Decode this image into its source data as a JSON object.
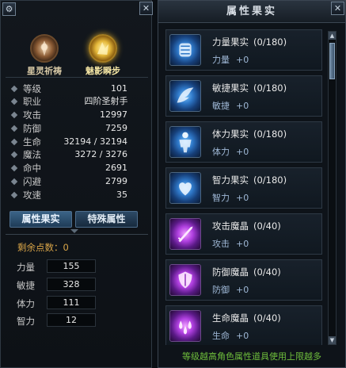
{
  "left_panel": {
    "skills": [
      {
        "name": "星灵祈祷"
      },
      {
        "name": "魅影瞬步"
      }
    ],
    "stats": [
      {
        "label": "等级",
        "value": "101"
      },
      {
        "label": "职业",
        "value": "四阶圣射手"
      },
      {
        "label": "攻击",
        "value": "12997"
      },
      {
        "label": "防御",
        "value": "7259"
      },
      {
        "label": "生命",
        "value": "32194 / 32194"
      },
      {
        "label": "魔法",
        "value": "3272 / 3276"
      },
      {
        "label": "命中",
        "value": "2691"
      },
      {
        "label": "闪避",
        "value": "2799"
      },
      {
        "label": "攻速",
        "value": "35"
      }
    ],
    "tabs": {
      "fruit": "属性果实",
      "special": "特殊属性"
    },
    "remaining_label": "剩余点数：0",
    "attributes": [
      {
        "label": "力量",
        "value": "155"
      },
      {
        "label": "敏捷",
        "value": "328"
      },
      {
        "label": "体力",
        "value": "111"
      },
      {
        "label": "智力",
        "value": "12"
      }
    ]
  },
  "right_panel": {
    "title": "属性果实",
    "items": [
      {
        "name": "力量果实",
        "count": "(0/180)",
        "stat": "力量",
        "bonus": "+0",
        "color": "blue",
        "icon": "fist-icon"
      },
      {
        "name": "敏捷果实",
        "count": "(0/180)",
        "stat": "敏捷",
        "bonus": "+0",
        "color": "blue",
        "icon": "wing-icon"
      },
      {
        "name": "体力果实",
        "count": "(0/180)",
        "stat": "体力",
        "bonus": "+0",
        "color": "blue",
        "icon": "body-icon"
      },
      {
        "name": "智力果实",
        "count": "(0/180)",
        "stat": "智力",
        "bonus": "+0",
        "color": "blue",
        "icon": "heart-icon"
      },
      {
        "name": "攻击魔晶",
        "count": "(0/40)",
        "stat": "攻击",
        "bonus": "+0",
        "color": "purple",
        "icon": "sword-icon"
      },
      {
        "name": "防御魔晶",
        "count": "(0/40)",
        "stat": "防御",
        "bonus": "+0",
        "color": "purple",
        "icon": "shield-icon"
      },
      {
        "name": "生命魔晶",
        "count": "(0/40)",
        "stat": "生命",
        "bonus": "+0",
        "color": "purple",
        "icon": "drops-icon"
      }
    ],
    "footer": "等级越高角色属性道具使用上限越多"
  },
  "colors": {
    "accent_gold": "#d9a548",
    "footer_green": "#6fbf3c",
    "stat_blue": "#9fb8d6"
  }
}
